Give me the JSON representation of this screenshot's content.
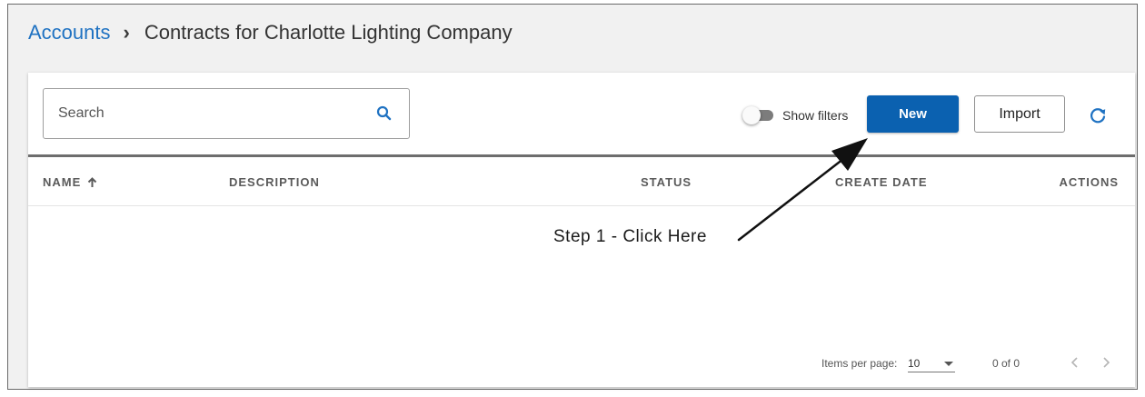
{
  "breadcrumb": {
    "link": "Accounts",
    "separator": "›",
    "current": "Contracts for Charlotte Lighting Company"
  },
  "toolbar": {
    "search_placeholder": "Search",
    "search_icon": "search-icon",
    "show_filters_label": "Show filters",
    "show_filters_on": false,
    "new_label": "New",
    "import_label": "Import",
    "refresh_icon": "refresh-icon"
  },
  "table": {
    "columns": [
      "NAME",
      "DESCRIPTION",
      "STATUS",
      "CREATE DATE",
      "ACTIONS"
    ],
    "sort_column": "NAME",
    "sort_direction": "asc",
    "rows": []
  },
  "annotation": {
    "text": "Step 1 - Click Here"
  },
  "paginator": {
    "items_per_page_label": "Items per page:",
    "items_per_page_value": "10",
    "range_label": "0 of 0"
  },
  "colors": {
    "accent": "#0b61b0",
    "link": "#1f72c2",
    "page_background": "#f1f1f1"
  }
}
